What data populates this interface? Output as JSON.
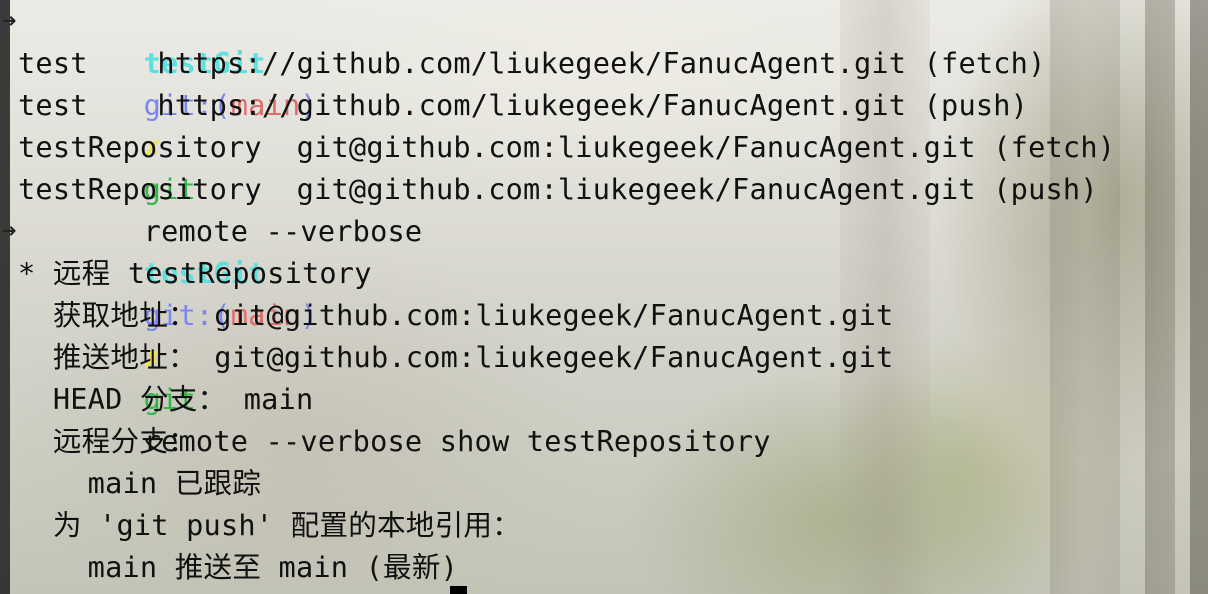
{
  "prompt": {
    "arrow": "➜",
    "directory": "testGit",
    "git_label": "git:(",
    "branch": "main",
    "git_close": ")",
    "dirty_marker": "✗",
    "command_word": "git"
  },
  "commands": [
    "remote --verbose",
    "remote --verbose show testRepository"
  ],
  "remote_list": [
    {
      "name": "test",
      "pad": "    ",
      "url": "https://github.com/liukegeek/FanucAgent.git",
      "mode": "(fetch)"
    },
    {
      "name": "test",
      "pad": "    ",
      "url": "https://github.com/liukegeek/FanucAgent.git",
      "mode": "(push)"
    },
    {
      "name": "testRepository",
      "pad": "  ",
      "url": "git@github.com:liukegeek/FanucAgent.git",
      "mode": "(fetch)"
    },
    {
      "name": "testRepository",
      "pad": "  ",
      "url": "git@github.com:liukegeek/FanucAgent.git",
      "mode": "(push)"
    }
  ],
  "show_output": [
    "* 远程 testRepository",
    "  获取地址： git@github.com:liukegeek/FanucAgent.git",
    "  推送地址： git@github.com:liukegeek/FanucAgent.git",
    "  HEAD 分支： main",
    "  远程分支：",
    "    main 已跟踪",
    "  为 'git push' 配置的本地引用：",
    "    main 推送至 main (最新)"
  ]
}
